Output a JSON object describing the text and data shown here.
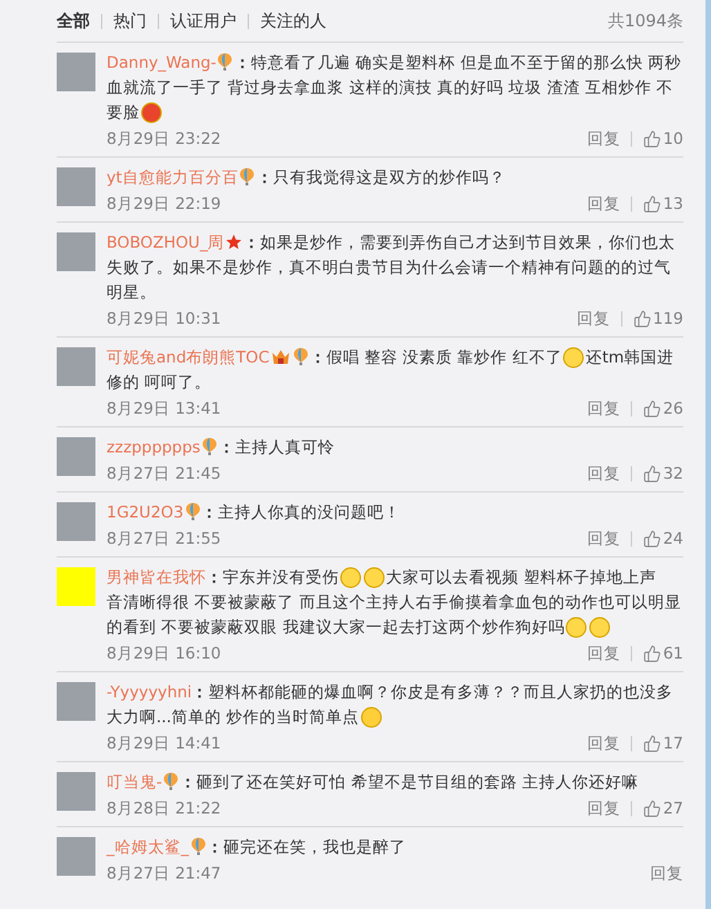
{
  "tabs": [
    {
      "label": "全部",
      "selected": true
    },
    {
      "label": "热门",
      "selected": false
    },
    {
      "label": "认证用户",
      "selected": false
    },
    {
      "label": "关注的人",
      "selected": false
    }
  ],
  "total": "共1094条",
  "comments": [
    {
      "avatar": {
        "kind": "photo"
      },
      "user": "Danny_Wang-",
      "badges": [
        {
          "kind": "balloon"
        }
      ],
      "lines": [
        [
          {
            "kind": "text",
            "text": "**：**特意看了几遍 确实是塑料杯 但是血不至于留的那么快 两秒"
          }
        ],
        [
          {
            "kind": "text",
            "text": "血就流了一手了 背过身去拿血浆 这样的演技 真的好吗 垃圾 渣渣 互相炒作 不"
          }
        ],
        [
          {
            "kind": "text",
            "text": "要脸"
          },
          {
            "kind": "angry"
          }
        ]
      ],
      "date": "8月29日 23:22",
      "reply": "回复",
      "likes": "10"
    },
    {
      "avatar": {
        "kind": "photo"
      },
      "user": "yt自愈能力百分百",
      "badges": [
        {
          "kind": "balloon"
        }
      ],
      "lines": [
        [
          {
            "kind": "text",
            "text": "**：**只有我觉得这是双方的炒作吗？"
          }
        ]
      ],
      "date": "8月29日 22:19",
      "reply": "回复",
      "likes": "13"
    },
    {
      "avatar": {
        "kind": "photo"
      },
      "user": "BOBOZHOU_周",
      "badges": [
        {
          "kind": "star"
        }
      ],
      "lines": [
        [
          {
            "kind": "text",
            "text": "**：**如果是炒作，需要到弄伤自己才达到节目效果，你们也太"
          }
        ],
        [
          {
            "kind": "text",
            "text": "失败了。如果不是炒作，真不明白贵节目为什么会请一个精神有问题的的过气"
          }
        ],
        [
          {
            "kind": "text",
            "text": "明星。"
          }
        ]
      ],
      "date": "8月29日 10:31",
      "reply": "回复",
      "likes": "119"
    },
    {
      "avatar": {
        "kind": "photo"
      },
      "user": "可妮兔and布朗熊TOC",
      "badges": [
        {
          "kind": "crown"
        },
        {
          "kind": "balloon"
        }
      ],
      "lines": [
        [
          {
            "kind": "text",
            "text": "**：**假唱 整容 没素质 靠炒作 红不了"
          },
          {
            "kind": "meh"
          },
          {
            "kind": "text",
            "text": "还tm韩国进"
          }
        ],
        [
          {
            "kind": "text",
            "text": "修的 呵呵了。"
          }
        ]
      ],
      "date": "8月29日 13:41",
      "reply": "回复",
      "likes": "26"
    },
    {
      "avatar": {
        "kind": "photo"
      },
      "user": "zzzpppppps",
      "badges": [
        {
          "kind": "balloon"
        }
      ],
      "lines": [
        [
          {
            "kind": "text",
            "text": "**：**主持人真可怜"
          }
        ]
      ],
      "date": "8月27日 21:45",
      "reply": "回复",
      "likes": "32"
    },
    {
      "avatar": {
        "kind": "photo"
      },
      "user": "1G2U2O3",
      "badges": [
        {
          "kind": "balloon"
        }
      ],
      "lines": [
        [
          {
            "kind": "text",
            "text": "**：**主持人你真的没问题吧！"
          }
        ]
      ],
      "date": "8月27日 21:55",
      "reply": "回复",
      "likes": "24"
    },
    {
      "avatar": {
        "kind": "solid",
        "color": "#ffff00"
      },
      "user": "男神皆在我怀",
      "lines": [
        [
          {
            "kind": "text",
            "text": "**：**宇东并没有受伤"
          },
          {
            "kind": "meh"
          },
          {
            "kind": "meh"
          },
          {
            "kind": "text",
            "text": "大家可以去看视频 塑料杯子掉地上声"
          }
        ],
        [
          {
            "kind": "text",
            "text": "音清晰得很 不要被蒙蔽了 而且这个主持人右手偷摸着拿血包的动作也可以明显"
          }
        ],
        [
          {
            "kind": "text",
            "text": "的看到  不要被蒙蔽双眼 我建议大家一起去打这两个炒作狗好吗"
          },
          {
            "kind": "meh"
          },
          {
            "kind": "meh"
          }
        ]
      ],
      "date": "8月29日 16:10",
      "reply": "回复",
      "likes": "61"
    },
    {
      "avatar": {
        "kind": "photo"
      },
      "user": "-Yyyyyyhni",
      "lines": [
        [
          {
            "kind": "text",
            "text": "**：**塑料杯都能砸的爆血啊？你皮是有多薄？？而且人家扔的也没多"
          }
        ],
        [
          {
            "kind": "text",
            "text": "大力啊...简单的 炒作的当时简单点"
          },
          {
            "kind": "eyeroll"
          }
        ]
      ],
      "date": "8月29日 14:41",
      "reply": "回复",
      "likes": "17"
    },
    {
      "avatar": {
        "kind": "photo"
      },
      "user": "叮当鬼-",
      "badges": [
        {
          "kind": "balloon"
        }
      ],
      "lines": [
        [
          {
            "kind": "text",
            "text": "**：**砸到了还在笑好可怕 希望不是节目组的套路 主持人你还好嘛"
          }
        ]
      ],
      "date": "8月28日 21:22",
      "reply": "回复",
      "likes": "27"
    },
    {
      "avatar": {
        "kind": "photo"
      },
      "user": "_哈姆太鲨_",
      "badges": [
        {
          "kind": "balloon"
        }
      ],
      "lines": [
        [
          {
            "kind": "text",
            "text": "**：**砸完还在笑，我也是醉了"
          }
        ]
      ],
      "date": "8月27日 21:47",
      "reply": "回复"
    }
  ]
}
